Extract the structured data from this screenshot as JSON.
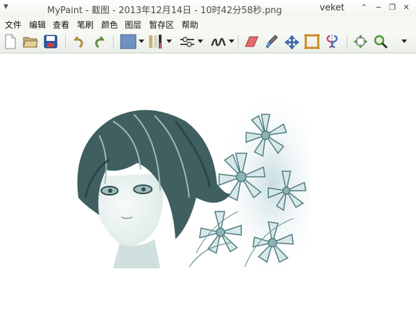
{
  "window": {
    "title": "MyPaint - 截图 - 2013年12月14日 - 10时42分58秒.png",
    "user": "veket",
    "controls": [
      "⌃",
      "−",
      "❐",
      "✕"
    ]
  },
  "menu": [
    {
      "label": "文件"
    },
    {
      "label": "编辑"
    },
    {
      "label": "查看"
    },
    {
      "label": "笔刷"
    },
    {
      "label": "颜色"
    },
    {
      "label": "图层"
    },
    {
      "label": "暂存区"
    },
    {
      "label": "帮助"
    }
  ],
  "toolbar": {
    "icons": [
      "new-file-icon",
      "open-folder-icon",
      "save-icon",
      "undo-icon",
      "redo-icon",
      "color-swatch-icon",
      "brush-icon",
      "adjust-icon",
      "stroke-icon",
      "eraser-icon",
      "picker-icon",
      "pan-icon",
      "frame-icon",
      "symmetry-icon",
      "move-icon",
      "zoom-icon",
      "overflow-icon"
    ],
    "current_color": "#6e93c3"
  }
}
